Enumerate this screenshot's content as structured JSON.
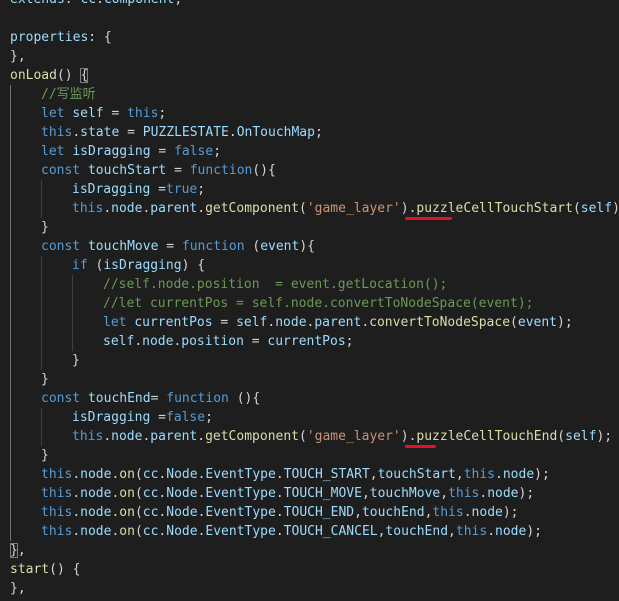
{
  "editor": {
    "theme": "dark",
    "colors": {
      "background": "#1e1e1e",
      "keyword": "#569cd6",
      "variable": "#9cdcfe",
      "function": "#dcdcaa",
      "string": "#ce9178",
      "comment": "#6a9955",
      "plain": "#d4d4d4",
      "annotation": "#e81123"
    },
    "lines": [
      {
        "indent": 0,
        "tokens": [
          [
            "var",
            "extends"
          ],
          [
            "pl",
            ": "
          ],
          [
            "var",
            "cc"
          ],
          [
            "pl",
            "."
          ],
          [
            "var",
            "Component"
          ],
          [
            "pl",
            ","
          ]
        ]
      },
      {
        "indent": 0,
        "tokens": []
      },
      {
        "indent": 0,
        "tokens": [
          [
            "var",
            "properties"
          ],
          [
            "pl",
            ": {"
          ]
        ]
      },
      {
        "indent": 0,
        "tokens": [
          [
            "pl",
            "},"
          ]
        ]
      },
      {
        "indent": 0,
        "tokens": [
          [
            "fn",
            "onLoad"
          ],
          [
            "pl",
            "() "
          ],
          [
            "pl",
            "{"
          ]
        ],
        "braceBox": 2
      },
      {
        "indent": 1,
        "tokens": [
          [
            "cm",
            "//写监听"
          ]
        ]
      },
      {
        "indent": 1,
        "tokens": [
          [
            "kw",
            "let "
          ],
          [
            "var",
            "self"
          ],
          [
            "pl",
            " = "
          ],
          [
            "kw",
            "this"
          ],
          [
            "pl",
            ";"
          ]
        ]
      },
      {
        "indent": 1,
        "tokens": [
          [
            "kw",
            "this"
          ],
          [
            "pl",
            "."
          ],
          [
            "var",
            "state"
          ],
          [
            "pl",
            " = "
          ],
          [
            "var",
            "PUZZLESTATE"
          ],
          [
            "pl",
            "."
          ],
          [
            "var",
            "OnTouchMap"
          ],
          [
            "pl",
            ";"
          ]
        ]
      },
      {
        "indent": 1,
        "tokens": [
          [
            "kw",
            "let "
          ],
          [
            "var",
            "isDragging"
          ],
          [
            "pl",
            " = "
          ],
          [
            "kw",
            "false"
          ],
          [
            "pl",
            ";"
          ]
        ]
      },
      {
        "indent": 1,
        "tokens": [
          [
            "kw",
            "const "
          ],
          [
            "var",
            "touchStart"
          ],
          [
            "pl",
            " = "
          ],
          [
            "kw",
            "function"
          ],
          [
            "pl",
            "(){"
          ]
        ]
      },
      {
        "indent": 2,
        "tokens": [
          [
            "var",
            "isDragging"
          ],
          [
            "pl",
            " ="
          ],
          [
            "kw",
            "true"
          ],
          [
            "pl",
            ";"
          ]
        ]
      },
      {
        "indent": 2,
        "tokens": [
          [
            "kw",
            "this"
          ],
          [
            "pl",
            "."
          ],
          [
            "var",
            "node"
          ],
          [
            "pl",
            "."
          ],
          [
            "var",
            "parent"
          ],
          [
            "pl",
            "."
          ],
          [
            "fn",
            "getComponent"
          ],
          [
            "pl",
            "("
          ],
          [
            "str",
            "'game_layer'"
          ],
          [
            "pl",
            ")."
          ],
          [
            "fn",
            "puzzleCellTouchStart"
          ],
          [
            "pl",
            "("
          ],
          [
            "var",
            "self"
          ],
          [
            "pl",
            ");"
          ]
        ]
      },
      {
        "indent": 1,
        "tokens": [
          [
            "pl",
            "}"
          ]
        ]
      },
      {
        "indent": 1,
        "tokens": [
          [
            "kw",
            "const "
          ],
          [
            "var",
            "touchMove"
          ],
          [
            "pl",
            " = "
          ],
          [
            "kw",
            "function"
          ],
          [
            "pl",
            " ("
          ],
          [
            "var",
            "event"
          ],
          [
            "pl",
            "){"
          ]
        ]
      },
      {
        "indent": 2,
        "tokens": [
          [
            "kw",
            "if"
          ],
          [
            "pl",
            " ("
          ],
          [
            "var",
            "isDragging"
          ],
          [
            "pl",
            ") {"
          ]
        ]
      },
      {
        "indent": 3,
        "tokens": [
          [
            "cm",
            "//self.node.position  = event.getLocation();"
          ]
        ]
      },
      {
        "indent": 3,
        "tokens": [
          [
            "cm",
            "//let currentPos = self.node.convertToNodeSpace(event);"
          ]
        ]
      },
      {
        "indent": 3,
        "tokens": [
          [
            "kw",
            "let "
          ],
          [
            "var",
            "currentPos"
          ],
          [
            "pl",
            " = "
          ],
          [
            "var",
            "self"
          ],
          [
            "pl",
            "."
          ],
          [
            "var",
            "node"
          ],
          [
            "pl",
            "."
          ],
          [
            "var",
            "parent"
          ],
          [
            "pl",
            "."
          ],
          [
            "fn",
            "convertToNodeSpace"
          ],
          [
            "pl",
            "("
          ],
          [
            "var",
            "event"
          ],
          [
            "pl",
            ");"
          ]
        ]
      },
      {
        "indent": 3,
        "tokens": [
          [
            "var",
            "self"
          ],
          [
            "pl",
            "."
          ],
          [
            "var",
            "node"
          ],
          [
            "pl",
            "."
          ],
          [
            "var",
            "position"
          ],
          [
            "pl",
            " = "
          ],
          [
            "var",
            "currentPos"
          ],
          [
            "pl",
            ";"
          ]
        ]
      },
      {
        "indent": 2,
        "tokens": [
          [
            "pl",
            "}"
          ]
        ]
      },
      {
        "indent": 1,
        "tokens": [
          [
            "pl",
            "}"
          ]
        ]
      },
      {
        "indent": 1,
        "tokens": [
          [
            "kw",
            "const "
          ],
          [
            "var",
            "touchEnd"
          ],
          [
            "pl",
            "= "
          ],
          [
            "kw",
            "function"
          ],
          [
            "pl",
            " (){"
          ]
        ]
      },
      {
        "indent": 2,
        "tokens": [
          [
            "var",
            "isDragging"
          ],
          [
            "pl",
            " ="
          ],
          [
            "kw",
            "false"
          ],
          [
            "pl",
            ";"
          ]
        ]
      },
      {
        "indent": 2,
        "tokens": [
          [
            "kw",
            "this"
          ],
          [
            "pl",
            "."
          ],
          [
            "var",
            "node"
          ],
          [
            "pl",
            "."
          ],
          [
            "var",
            "parent"
          ],
          [
            "pl",
            "."
          ],
          [
            "fn",
            "getComponent"
          ],
          [
            "pl",
            "("
          ],
          [
            "str",
            "'game_layer'"
          ],
          [
            "pl",
            ")."
          ],
          [
            "fn",
            "puzzleCellTouchEnd"
          ],
          [
            "pl",
            "("
          ],
          [
            "var",
            "self"
          ],
          [
            "pl",
            ");"
          ]
        ]
      },
      {
        "indent": 1,
        "tokens": [
          [
            "pl",
            "}"
          ]
        ]
      },
      {
        "indent": 1,
        "tokens": [
          [
            "kw",
            "this"
          ],
          [
            "pl",
            "."
          ],
          [
            "var",
            "node"
          ],
          [
            "pl",
            "."
          ],
          [
            "fn",
            "on"
          ],
          [
            "pl",
            "("
          ],
          [
            "var",
            "cc"
          ],
          [
            "pl",
            "."
          ],
          [
            "var",
            "Node"
          ],
          [
            "pl",
            "."
          ],
          [
            "var",
            "EventType"
          ],
          [
            "pl",
            "."
          ],
          [
            "var",
            "TOUCH_START"
          ],
          [
            "pl",
            ","
          ],
          [
            "var",
            "touchStart"
          ],
          [
            "pl",
            ","
          ],
          [
            "kw",
            "this"
          ],
          [
            "pl",
            "."
          ],
          [
            "var",
            "node"
          ],
          [
            "pl",
            ");"
          ]
        ]
      },
      {
        "indent": 1,
        "tokens": [
          [
            "kw",
            "this"
          ],
          [
            "pl",
            "."
          ],
          [
            "var",
            "node"
          ],
          [
            "pl",
            "."
          ],
          [
            "fn",
            "on"
          ],
          [
            "pl",
            "("
          ],
          [
            "var",
            "cc"
          ],
          [
            "pl",
            "."
          ],
          [
            "var",
            "Node"
          ],
          [
            "pl",
            "."
          ],
          [
            "var",
            "EventType"
          ],
          [
            "pl",
            "."
          ],
          [
            "var",
            "TOUCH_MOVE"
          ],
          [
            "pl",
            ","
          ],
          [
            "var",
            "touchMove"
          ],
          [
            "pl",
            ","
          ],
          [
            "kw",
            "this"
          ],
          [
            "pl",
            "."
          ],
          [
            "var",
            "node"
          ],
          [
            "pl",
            ");"
          ]
        ]
      },
      {
        "indent": 1,
        "tokens": [
          [
            "kw",
            "this"
          ],
          [
            "pl",
            "."
          ],
          [
            "var",
            "node"
          ],
          [
            "pl",
            "."
          ],
          [
            "fn",
            "on"
          ],
          [
            "pl",
            "("
          ],
          [
            "var",
            "cc"
          ],
          [
            "pl",
            "."
          ],
          [
            "var",
            "Node"
          ],
          [
            "pl",
            "."
          ],
          [
            "var",
            "EventType"
          ],
          [
            "pl",
            "."
          ],
          [
            "var",
            "TOUCH_END"
          ],
          [
            "pl",
            ","
          ],
          [
            "var",
            "touchEnd"
          ],
          [
            "pl",
            ","
          ],
          [
            "kw",
            "this"
          ],
          [
            "pl",
            "."
          ],
          [
            "var",
            "node"
          ],
          [
            "pl",
            ");"
          ]
        ]
      },
      {
        "indent": 1,
        "tokens": [
          [
            "kw",
            "this"
          ],
          [
            "pl",
            "."
          ],
          [
            "var",
            "node"
          ],
          [
            "pl",
            "."
          ],
          [
            "fn",
            "on"
          ],
          [
            "pl",
            "("
          ],
          [
            "var",
            "cc"
          ],
          [
            "pl",
            "."
          ],
          [
            "var",
            "Node"
          ],
          [
            "pl",
            "."
          ],
          [
            "var",
            "EventType"
          ],
          [
            "pl",
            "."
          ],
          [
            "var",
            "TOUCH_CANCEL"
          ],
          [
            "pl",
            ","
          ],
          [
            "var",
            "touchEnd"
          ],
          [
            "pl",
            ","
          ],
          [
            "kw",
            "this"
          ],
          [
            "pl",
            "."
          ],
          [
            "var",
            "node"
          ],
          [
            "pl",
            ");"
          ]
        ]
      },
      {
        "indent": 0,
        "tokens": [
          [
            "pl",
            "}"
          ],
          [
            "pl",
            ","
          ]
        ],
        "braceBox": 0
      },
      {
        "indent": 0,
        "tokens": [
          [
            "fn",
            "start"
          ],
          [
            "pl",
            "() {"
          ]
        ]
      },
      {
        "indent": 0,
        "tokens": [
          [
            "pl",
            "},"
          ]
        ]
      }
    ],
    "annotations": [
      {
        "type": "underline",
        "line": 11,
        "token": 9,
        "target": "Start"
      },
      {
        "type": "underline",
        "line": 23,
        "token": 9,
        "target": "End"
      }
    ]
  }
}
